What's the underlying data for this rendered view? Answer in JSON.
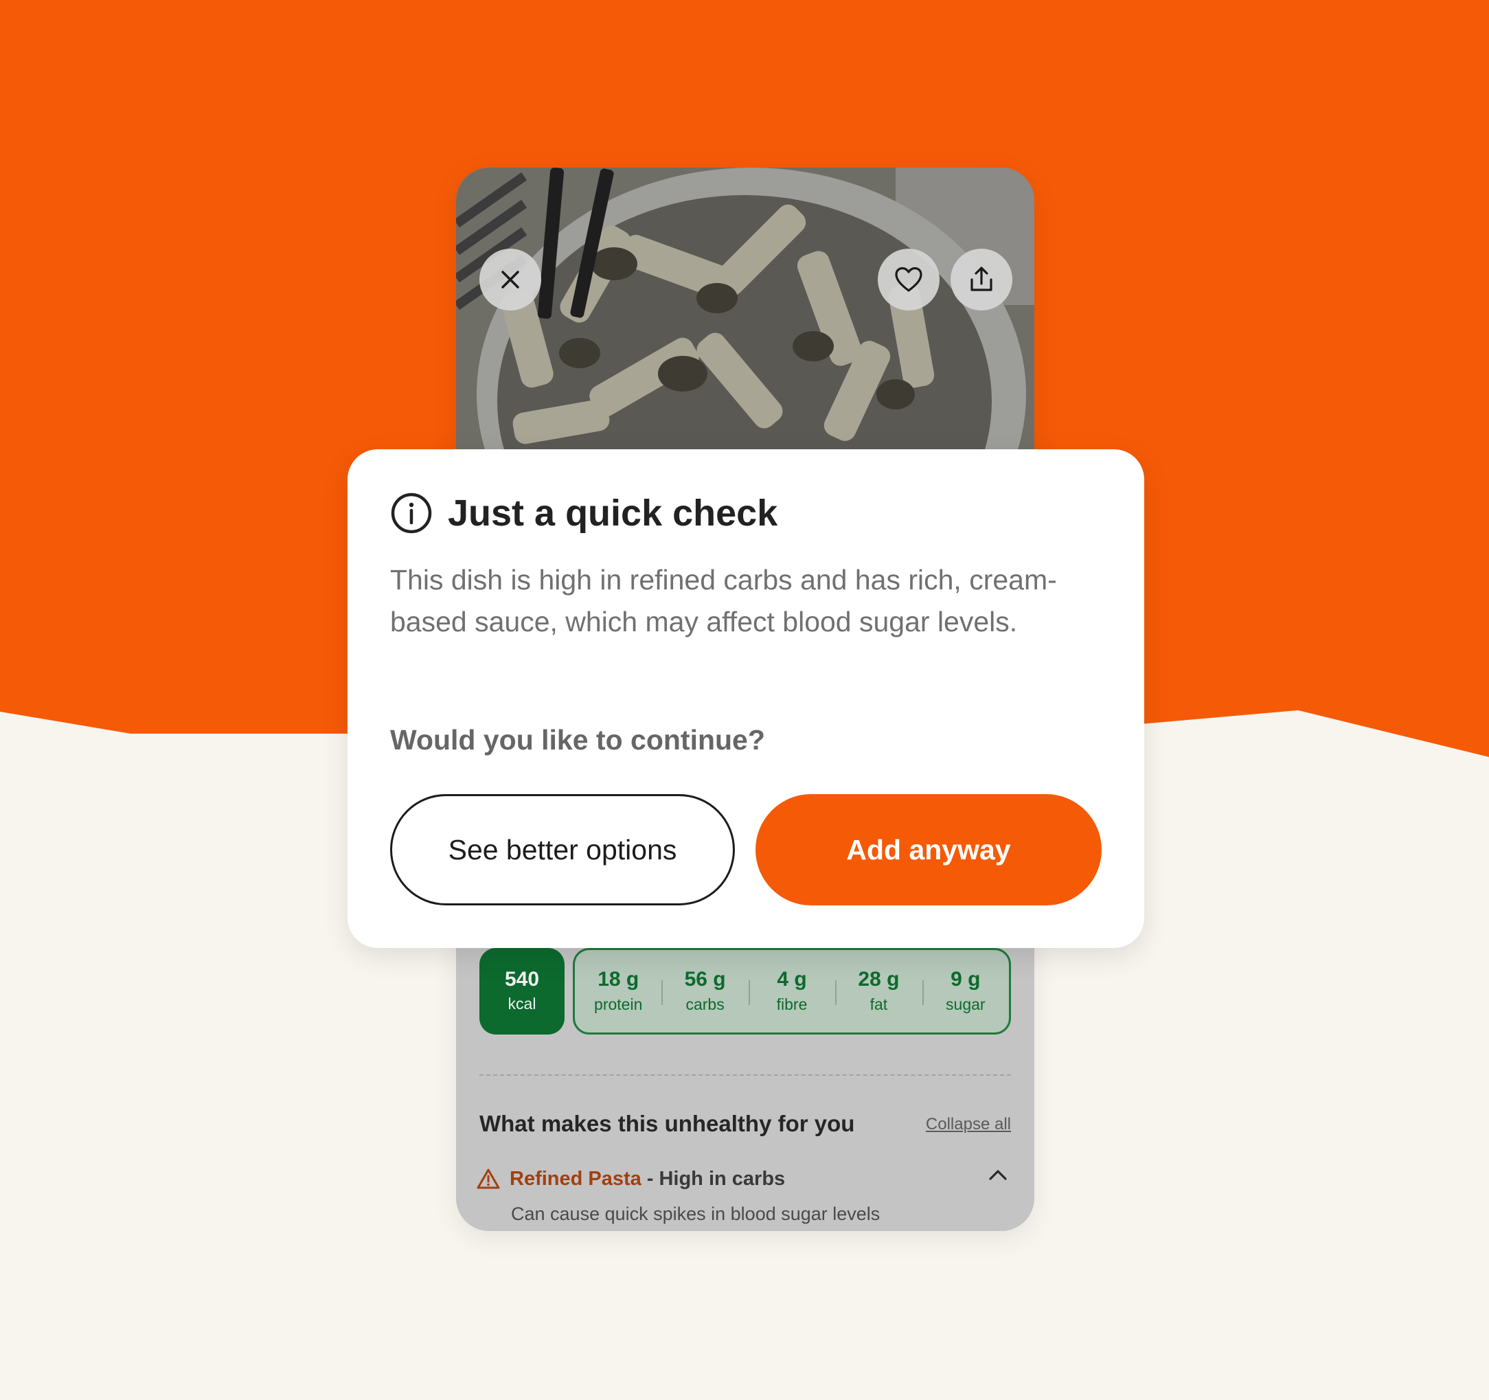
{
  "colors": {
    "brand_orange": "#F55A07",
    "background_cream": "#F8F5EF",
    "kcal_green": "#0C6A2E",
    "warning_orange": "#A2400E"
  },
  "photo": {
    "close_icon": "close-icon",
    "heart_icon": "heart-icon",
    "share_icon": "share-icon"
  },
  "modal": {
    "title": "Just a quick check",
    "body": "This dish is high in refined carbs and has rich, cream-based sauce, which may affect blood sugar levels.",
    "question": "Would you like to continue?",
    "secondary_button": "See better options",
    "primary_button": "Add anyway"
  },
  "nutrition": {
    "kcal_value": "540",
    "kcal_unit": "kcal",
    "macros": [
      {
        "value": "18 g",
        "label": "protein"
      },
      {
        "value": "56 g",
        "label": "carbs"
      },
      {
        "value": "4 g",
        "label": "fibre"
      },
      {
        "value": "28 g",
        "label": "fat"
      },
      {
        "value": "9 g",
        "label": "sugar"
      }
    ]
  },
  "unhealthy": {
    "title": "What makes this unhealthy for you",
    "collapse_label": "Collapse all",
    "items": [
      {
        "name": "Refined Pasta",
        "separator": "-",
        "reason": "High in carbs",
        "detail": "Can cause quick spikes in blood sugar levels"
      }
    ]
  }
}
